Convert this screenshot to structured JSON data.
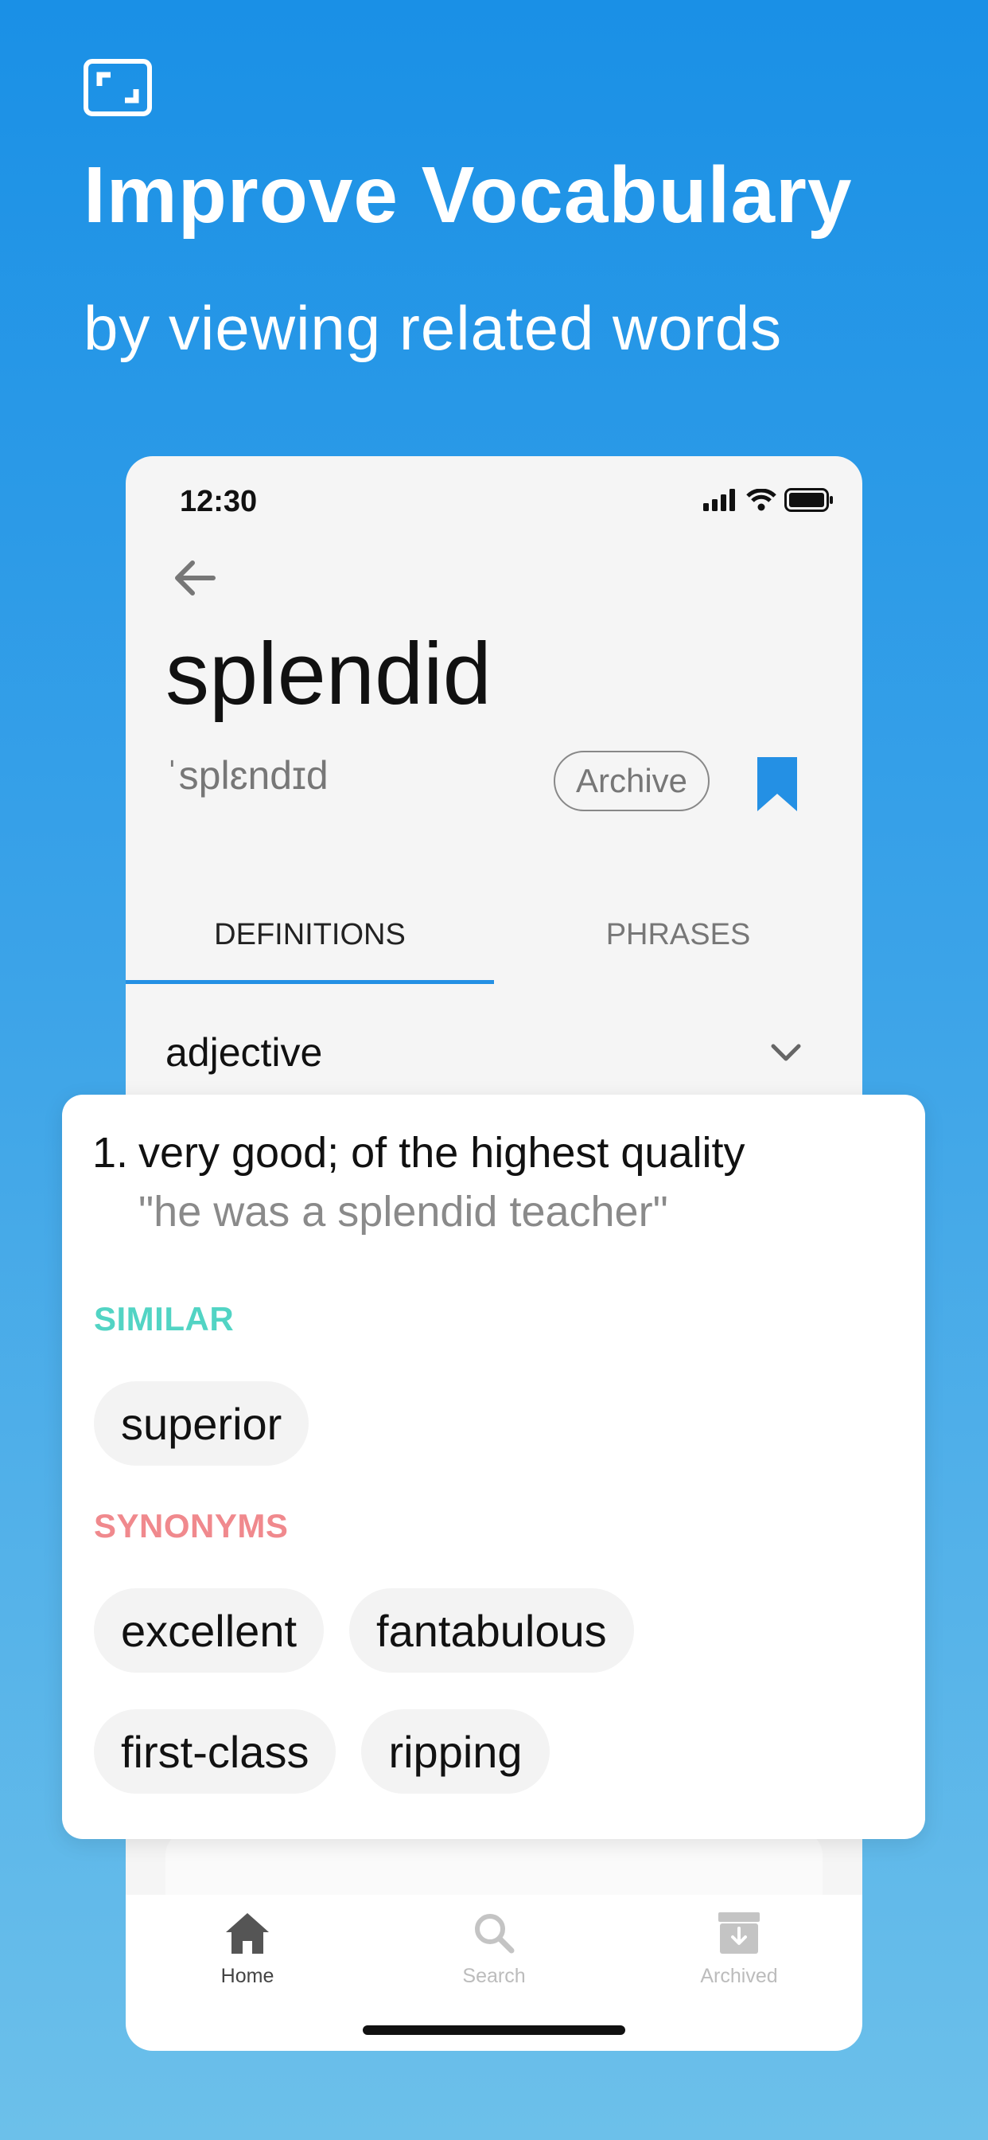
{
  "promo": {
    "headline": "Improve Vocabulary",
    "subheadline": "by viewing related words",
    "icon": "fullscreen-frame-icon"
  },
  "status_bar": {
    "time": "12:30",
    "icons": [
      "signal-icon",
      "wifi-icon",
      "battery-icon"
    ]
  },
  "entry": {
    "word": "splendid",
    "pronunciation": "ˈsplɛndɪd",
    "archive_label": "Archive",
    "bookmark_icon": "bookmark-icon"
  },
  "tabs": [
    {
      "label": "DEFINITIONS",
      "active": true
    },
    {
      "label": "PHRASES",
      "active": false
    }
  ],
  "part_of_speech": "adjective",
  "definition": {
    "number": "1.",
    "text": "very good; of the highest quality",
    "example": "\"he was a splendid teacher\""
  },
  "similar": {
    "title": "SIMILAR",
    "words": [
      "superior"
    ]
  },
  "synonyms": {
    "title": "SYNONYMS",
    "words": [
      "excellent",
      "fantabulous",
      "first-class",
      "ripping"
    ]
  },
  "bottom_nav": [
    {
      "label": "Home",
      "icon": "home-icon",
      "active": true
    },
    {
      "label": "Search",
      "icon": "search-icon",
      "active": false
    },
    {
      "label": "Archived",
      "icon": "archive-box-icon",
      "active": false
    }
  ],
  "colors": {
    "background_top": "#1a90e6",
    "background_bottom": "#6cc0ea",
    "accent": "#2490e4",
    "similar": "#52d4c4",
    "synonyms": "#f0898d"
  }
}
